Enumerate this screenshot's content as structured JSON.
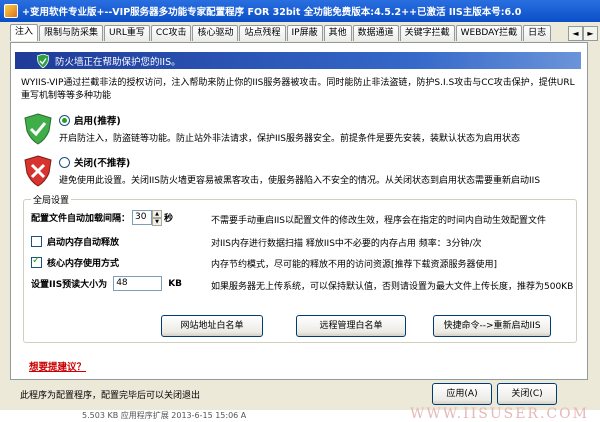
{
  "window": {
    "title": "+变用软件专业版+--VIP服务器多功能专家配置程序 FOR 32bit 全功能免费版本:4.5.2++已激活 IIS主版本号:6.0"
  },
  "tabs": [
    {
      "label": "注入",
      "active": true
    },
    {
      "label": "限制与防采集"
    },
    {
      "label": "URL重写"
    },
    {
      "label": "CC攻击"
    },
    {
      "label": "核心驱动"
    },
    {
      "label": "站点残程"
    },
    {
      "label": "IP屏蔽"
    },
    {
      "label": "其他"
    },
    {
      "label": "数据通道"
    },
    {
      "label": "关键字拦截"
    },
    {
      "label": "WEBDAY拦截"
    },
    {
      "label": "日志"
    }
  ],
  "tab_scroll": {
    "left": "◄",
    "right": "►"
  },
  "banner": {
    "text": "防火墙正在帮助保护您的IIS。"
  },
  "intro": "WYIIS-VIP通过拦截非法的授权访问，注入帮助来防止你的IIS服务器被攻击。同时能防止非法盗链，防护S.I.S攻击与CC攻击保护，提供URL重写机制等等多种功能",
  "enable_option": {
    "label": "启用(推荐)",
    "desc": "开启防注入，防盗链等功能。防止站外非法请求，保护IIS服务器安全。前提条件是要先安装，装默认状态为启用状态"
  },
  "disable_option": {
    "label": "关闭(不推荐)",
    "desc": "避免使用此设置。关闭IIS防火墙更容易被黑客攻击，使服务器陷入不安全的情况。从关闭状态到启用状态需要重新启动IIS"
  },
  "global": {
    "legend": "全局设置",
    "reload_label": "配置文件自动加载间隔：",
    "reload_value": "30",
    "reload_unit": "秒",
    "reload_desc": "不需要手动重启IIS以配置文件的修改生效，程序会在指定的时间内自动生效配置文件",
    "autofree_label": "启动内存自动释放",
    "autofree_desc": "对IIS内存进行数据扫描 释放IIS中不必要的内存占用  频率：3分钟/次",
    "core_mem_label": "核心内存使用方式",
    "core_mem_desc": "内存节约模式，尽可能的释放不用的访问资源[推荐下载资源服务器使用]",
    "upload_label": "设置IIS预读大小为",
    "upload_value": "48",
    "upload_unit": "KB",
    "upload_desc": "如果服务器无上传系统，可以保持默认值，否则请设置为最大文件上传长度，推荐为500KB"
  },
  "buttons": {
    "whitelist_site": "网站地址白名单",
    "whitelist_remote": "远程管理白名单",
    "restart_iis": "快捷命令-->重新启动IIS",
    "apply": "应用(A)",
    "close": "关闭(C)"
  },
  "link_suggest": "想要提建议？",
  "status": "此程序为配置程序，配置完毕后可以关闭退出",
  "background": {
    "file_row": "5.503 KB  应用程序扩展       2013-6-15  15:06     A",
    "watermark": "WWW.IISUSER.COM"
  }
}
